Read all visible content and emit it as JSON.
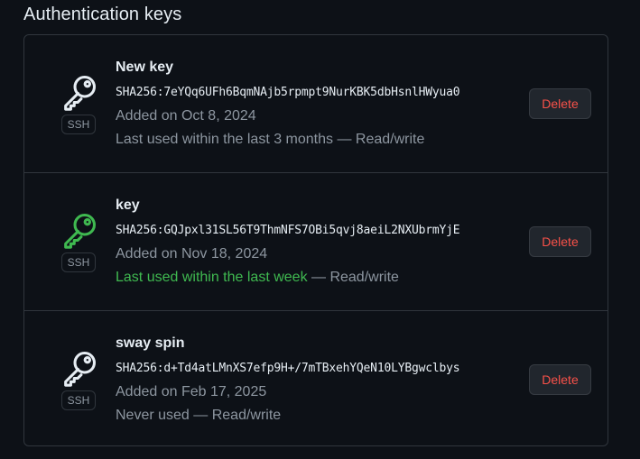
{
  "section": {
    "title": "Authentication keys"
  },
  "keys": [
    {
      "title": "New key",
      "type_label": "SSH",
      "fingerprint": "SHA256:7eYQq6UFh6BqmNAjb5rpmpt9NurKBK5dbHsnlHWyua0",
      "added": "Added on Oct 8, 2024",
      "usage_text": "Last used within the last 3 months",
      "usage_suffix": " — Read/write",
      "recent": false,
      "delete_label": "Delete",
      "icon": "key-icon",
      "icon_color": "#e6edf3"
    },
    {
      "title": "key",
      "type_label": "SSH",
      "fingerprint": "SHA256:GQJpxl31SL56T9ThmNFS7OBi5qvj8aeiL2NXUbrmYjE",
      "added": "Added on Nov 18, 2024",
      "usage_text": "Last used within the last week",
      "usage_suffix": " — Read/write",
      "recent": true,
      "delete_label": "Delete",
      "icon": "key-icon",
      "icon_color": "#3fb950"
    },
    {
      "title": "sway spin",
      "type_label": "SSH",
      "fingerprint": "SHA256:d+Td4atLMnXS7efp9H+/7mTBxehYQeN10LYBgwclbys",
      "added": "Added on Feb 17, 2025",
      "usage_text": "Never used",
      "usage_suffix": " — Read/write",
      "recent": false,
      "delete_label": "Delete",
      "icon": "key-icon",
      "icon_color": "#e6edf3"
    }
  ],
  "colors": {
    "background": "#0d1117",
    "border": "#30363d",
    "text_primary": "#e6edf3",
    "text_muted": "#8d96a0",
    "recent_green": "#3fb950",
    "danger_red": "#f85149"
  }
}
